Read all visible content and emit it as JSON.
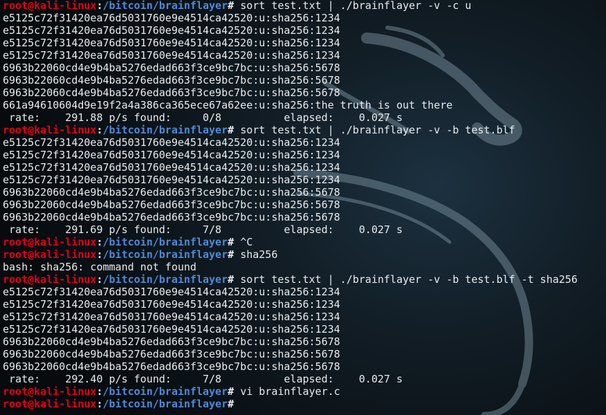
{
  "prompt": {
    "user_host": "root@kali-linux",
    "separator": ":",
    "path": "/bitcoin/brainflayer",
    "symbol": "# "
  },
  "lines": [
    {
      "type": "prompt",
      "text": "sort test.txt | ./brainflayer -v -c u"
    },
    {
      "type": "output",
      "text": "e5125c72f31420ea76d5031760e9e4514ca42520:u:sha256:1234"
    },
    {
      "type": "output",
      "text": "e5125c72f31420ea76d5031760e9e4514ca42520:u:sha256:1234"
    },
    {
      "type": "output",
      "text": "e5125c72f31420ea76d5031760e9e4514ca42520:u:sha256:1234"
    },
    {
      "type": "output",
      "text": "e5125c72f31420ea76d5031760e9e4514ca42520:u:sha256:1234"
    },
    {
      "type": "output",
      "text": "6963b22060cd4e9b4ba5276edad663f3ce9bc7bc:u:sha256:5678"
    },
    {
      "type": "output",
      "text": "6963b22060cd4e9b4ba5276edad663f3ce9bc7bc:u:sha256:5678"
    },
    {
      "type": "output",
      "text": "6963b22060cd4e9b4ba5276edad663f3ce9bc7bc:u:sha256:5678"
    },
    {
      "type": "output",
      "text": "661a94610604d9e19f2a4a386ca365ece67a62ee:u:sha256:the truth is out there"
    },
    {
      "type": "output",
      "text": " rate:    291.88 p/s found:     0/8          elapsed:    0.027 s"
    },
    {
      "type": "prompt",
      "text": "sort test.txt | ./brainflayer -v -b test.blf"
    },
    {
      "type": "output",
      "text": "e5125c72f31420ea76d5031760e9e4514ca42520:u:sha256:1234"
    },
    {
      "type": "output",
      "text": "e5125c72f31420ea76d5031760e9e4514ca42520:u:sha256:1234"
    },
    {
      "type": "output",
      "text": "e5125c72f31420ea76d5031760e9e4514ca42520:u:sha256:1234"
    },
    {
      "type": "output",
      "text": "e5125c72f31420ea76d5031760e9e4514ca42520:u:sha256:1234"
    },
    {
      "type": "output",
      "text": "6963b22060cd4e9b4ba5276edad663f3ce9bc7bc:u:sha256:5678"
    },
    {
      "type": "output",
      "text": "6963b22060cd4e9b4ba5276edad663f3ce9bc7bc:u:sha256:5678"
    },
    {
      "type": "output",
      "text": "6963b22060cd4e9b4ba5276edad663f3ce9bc7bc:u:sha256:5678"
    },
    {
      "type": "output",
      "text": " rate:    291.69 p/s found:     7/8          elapsed:    0.027 s"
    },
    {
      "type": "prompt",
      "text": "^C"
    },
    {
      "type": "prompt",
      "text": "sha256"
    },
    {
      "type": "output",
      "text": "bash: sha256: command not found"
    },
    {
      "type": "prompt",
      "text": "sort test.txt | ./brainflayer -v -b test.blf -t sha256"
    },
    {
      "type": "output",
      "text": "e5125c72f31420ea76d5031760e9e4514ca42520:u:sha256:1234"
    },
    {
      "type": "output",
      "text": "e5125c72f31420ea76d5031760e9e4514ca42520:u:sha256:1234"
    },
    {
      "type": "output",
      "text": "e5125c72f31420ea76d5031760e9e4514ca42520:u:sha256:1234"
    },
    {
      "type": "output",
      "text": "e5125c72f31420ea76d5031760e9e4514ca42520:u:sha256:1234"
    },
    {
      "type": "output",
      "text": "6963b22060cd4e9b4ba5276edad663f3ce9bc7bc:u:sha256:5678"
    },
    {
      "type": "output",
      "text": "6963b22060cd4e9b4ba5276edad663f3ce9bc7bc:u:sha256:5678"
    },
    {
      "type": "output",
      "text": "6963b22060cd4e9b4ba5276edad663f3ce9bc7bc:u:sha256:5678"
    },
    {
      "type": "output",
      "text": " rate:    292.40 p/s found:     7/8          elapsed:    0.027 s"
    },
    {
      "type": "prompt",
      "text": "vi brainflayer.c"
    },
    {
      "type": "prompt",
      "text": ""
    }
  ],
  "theme": {
    "background": "#0b1217",
    "text_color": "#e8ecee",
    "user_host_color": "#e2001a",
    "path_color": "#4e8ad8",
    "wallpaper_icon": "kali-dragon-icon"
  }
}
